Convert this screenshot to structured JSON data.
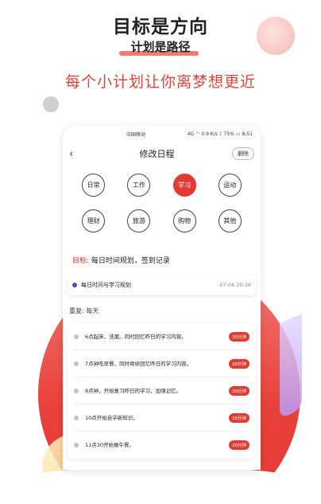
{
  "promo": {
    "headline": "目标是方向",
    "subhead": "计划是路径",
    "tagline": "每个小计划让你离梦想更近"
  },
  "statusbar": {
    "carrier": "中国移动",
    "net": "4G",
    "speed": "0.9 K/s",
    "battery": "75%",
    "time": "8:51"
  },
  "header": {
    "back_icon": "back-arrow-icon",
    "title": "修改日程",
    "delete_label": "删除"
  },
  "categories": [
    {
      "label": "日常",
      "active": false
    },
    {
      "label": "工作",
      "active": false
    },
    {
      "label": "学习",
      "active": true
    },
    {
      "label": "运动",
      "active": false
    },
    {
      "label": "理财",
      "active": false
    },
    {
      "label": "旅游",
      "active": false
    },
    {
      "label": "购物",
      "active": false
    },
    {
      "label": "其他",
      "active": false
    }
  ],
  "goal": {
    "label": "目标:",
    "value": "每日时间规划，签到记录"
  },
  "schedule": {
    "name": "每日时间与学习规划",
    "time": "07-06 20:36"
  },
  "repeat": {
    "label": "重复:",
    "value": "每天"
  },
  "tasks": [
    {
      "text": "6点起床，洗漱。同时回忆昨日的学习内容。",
      "badge": "30分钟"
    },
    {
      "text": "7点钟吃早餐，同时继续回忆昨日的学习内容。",
      "badge": "30分钟"
    },
    {
      "text": "8点钟，开始复习昨日的学习，加强记忆。",
      "badge": "30分钟"
    },
    {
      "text": "10点开始自学新知识。",
      "badge": "30分钟"
    },
    {
      "text": "11点30开始做午餐。",
      "badge": "30分钟"
    }
  ],
  "colors": {
    "accent": "#e23b31",
    "tagline": "#d9463c",
    "dot_blue": "#3b57c4"
  }
}
